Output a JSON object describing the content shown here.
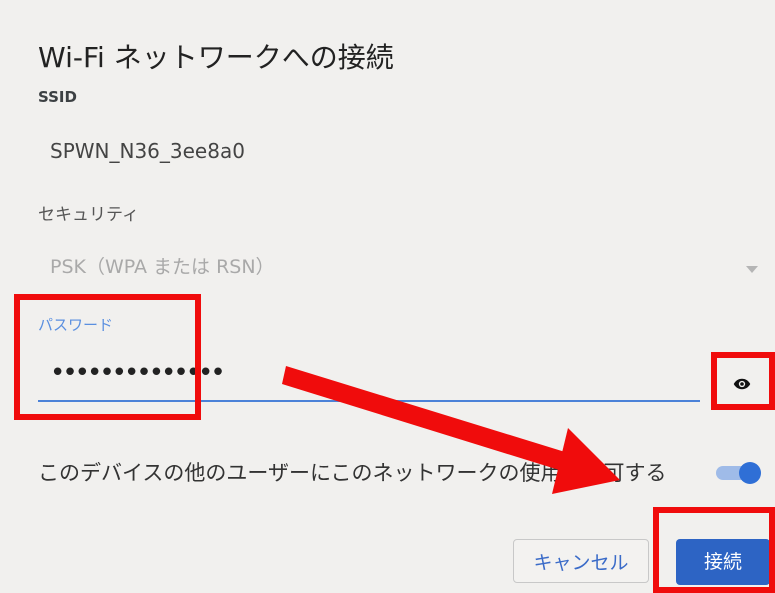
{
  "dialog": {
    "title": "Wi-Fi ネットワークへの接続",
    "ssid_label": "SSID",
    "ssid_value": "SPWN_N36_3ee8a0",
    "security_label": "セキュリティ",
    "security_value": "PSK（WPA または RSN）",
    "password_label": "パスワード",
    "password_value": "••••••••••••••",
    "share_label": "このデバイスの他のユーザーにこのネットワークの使用を許可する",
    "share_enabled": true,
    "cancel_label": "キャンセル",
    "connect_label": "接続"
  },
  "colors": {
    "accent": "#2d64c4",
    "highlight": "#f00c0c"
  },
  "icons": {
    "eye": "eye-icon",
    "dropdown": "chevron-down-icon"
  }
}
